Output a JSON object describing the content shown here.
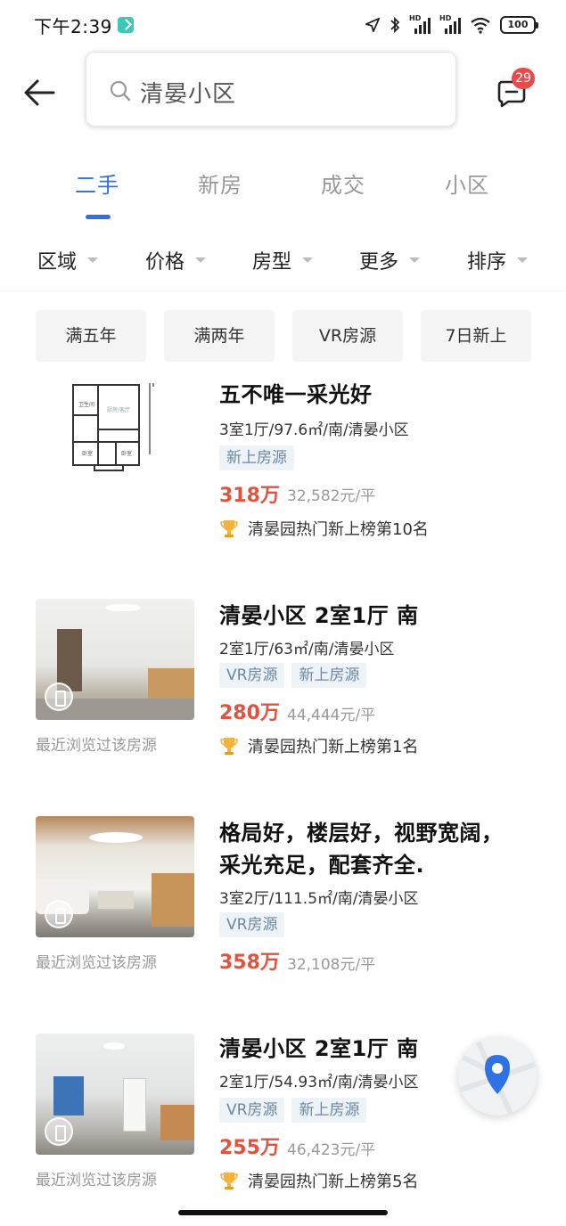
{
  "status_bar": {
    "time": "下午2:39",
    "battery": "100",
    "hd_label": "HD"
  },
  "search": {
    "query": "清晏小区",
    "message_count": "29"
  },
  "tabs": [
    {
      "label": "二手",
      "active": true
    },
    {
      "label": "新房",
      "active": false
    },
    {
      "label": "成交",
      "active": false
    },
    {
      "label": "小区",
      "active": false
    }
  ],
  "filters": [
    {
      "label": "区域"
    },
    {
      "label": "价格"
    },
    {
      "label": "房型"
    },
    {
      "label": "更多"
    },
    {
      "label": "排序"
    }
  ],
  "quick_chips": [
    {
      "label": "满五年"
    },
    {
      "label": "满两年"
    },
    {
      "label": "VR房源"
    },
    {
      "label": "7日新上"
    }
  ],
  "listings": [
    {
      "title_line1": "五不唯一采光好",
      "title_line2": "",
      "info": "3室1厅/97.6㎡/南/清晏小区",
      "tags": [
        "新上房源"
      ],
      "price": "318万",
      "unit_price": "32,582元/平",
      "rank": "清晏园热门新上榜第10名",
      "viewed": ""
    },
    {
      "title_line1": "清晏小区 2室1厅 南",
      "title_line2": "",
      "info": "2室1厅/63㎡/南/清晏小区",
      "tags": [
        "VR房源",
        "新上房源"
      ],
      "price": "280万",
      "unit_price": "44,444元/平",
      "rank": "清晏园热门新上榜第1名",
      "viewed": "最近浏览过该房源"
    },
    {
      "title_line1": "格局好，楼层好，视野宽阔，",
      "title_line2": "采光充足，配套齐全.",
      "info": "3室2厅/111.5㎡/南/清晏小区",
      "tags": [
        "VR房源"
      ],
      "price": "358万",
      "unit_price": "32,108元/平",
      "rank": "",
      "viewed": "最近浏览过该房源"
    },
    {
      "title_line1": "清晏小区 2室1厅 南",
      "title_line2": "",
      "info": "2室1厅/54.93㎡/南/清晏小区",
      "tags": [
        "VR房源",
        "新上房源"
      ],
      "price": "255万",
      "unit_price": "46,423元/平",
      "rank": "清晏园热门新上榜第5名",
      "viewed": "最近浏览过该房源"
    }
  ],
  "colors": {
    "accent": "#2f72e6",
    "price": "#e0533e",
    "badge": "#e84b4b",
    "tag_bg": "#eef3f8",
    "tag_text": "#6a88a6"
  },
  "icons": [
    "back-arrow-icon",
    "search-icon",
    "message-icon",
    "trophy-icon",
    "vr-icon",
    "map-pin-icon"
  ]
}
